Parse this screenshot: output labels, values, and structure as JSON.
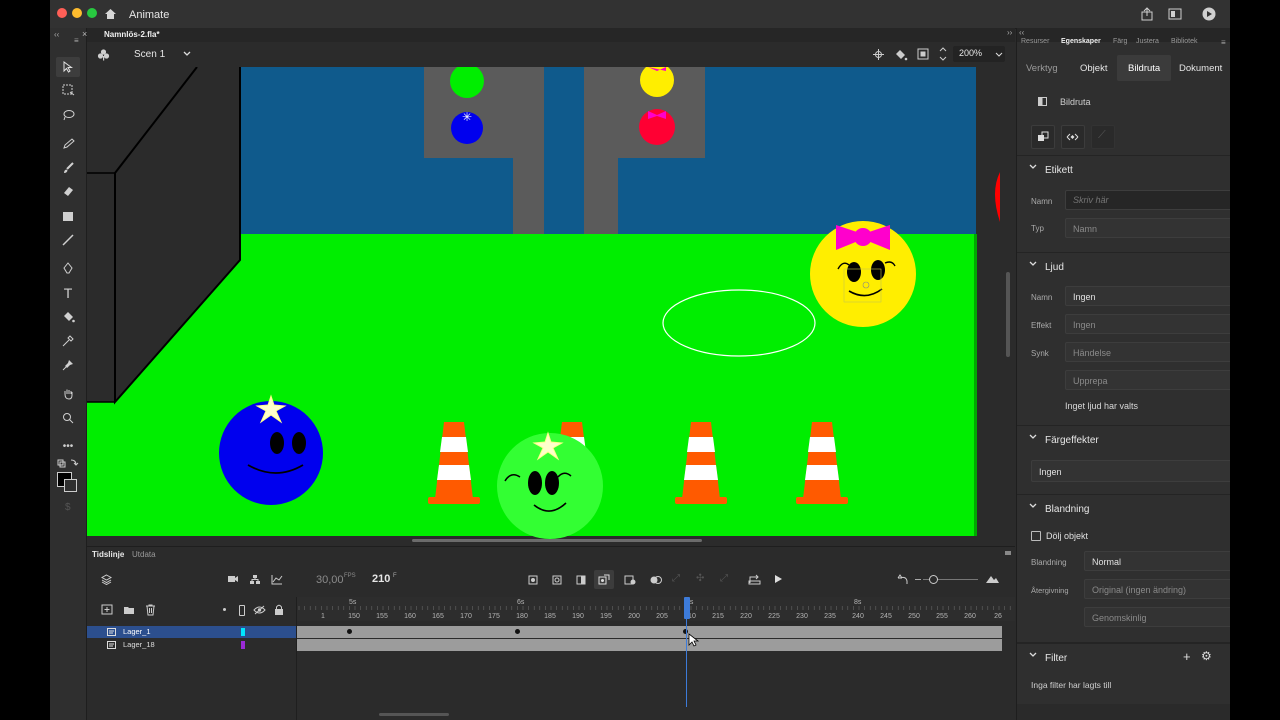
{
  "app": {
    "name": "Animate"
  },
  "document": {
    "tab": "Namnlös-2.fla*"
  },
  "scene": {
    "name": "Scen 1",
    "zoom": "200%"
  },
  "timeline": {
    "tabs": [
      "Tidslinje",
      "Utdata"
    ],
    "fps_value": "30,00",
    "fps_unit": "FPS",
    "frame_value": "210",
    "frame_unit": "F",
    "ruler_numbers": [
      "1",
      "150",
      "155",
      "160",
      "165",
      "170",
      "175",
      "180",
      "185",
      "190",
      "195",
      "200",
      "205",
      "210",
      "215",
      "220",
      "225",
      "230",
      "235",
      "240",
      "245",
      "250",
      "255",
      "260",
      "26"
    ],
    "seconds": [
      "5s",
      "6s",
      "7s",
      "8s"
    ],
    "layers": [
      {
        "name": "Lager_1",
        "color": "#00e5ff",
        "selected": true
      },
      {
        "name": "Lager_18",
        "color": "#9a2ad6",
        "selected": false
      }
    ]
  },
  "panel": {
    "top_tabs": [
      "Resurser",
      "Egenskaper",
      "Färg",
      "Justera",
      "Bibliotek"
    ],
    "active_top_tab": "Egenskaper",
    "sub_tabs": [
      "Verktyg",
      "Objekt",
      "Bildruta",
      "Dokument"
    ],
    "active_sub_tab": "Bildruta",
    "frame_title": "Bildruta",
    "label_section": {
      "title": "Etikett",
      "name_label": "Namn",
      "name_placeholder": "Skriv här",
      "type_label": "Typ",
      "type_value": "Namn"
    },
    "sound_section": {
      "title": "Ljud",
      "name_label": "Namn",
      "name_value": "Ingen",
      "effect_label": "Effekt",
      "effect_value": "Ingen",
      "sync_label": "Synk",
      "sync_value": "Händelse",
      "repeat_value": "Upprepa",
      "note": "Inget ljud har valts"
    },
    "color_effects": {
      "title": "Färgeffekter",
      "value": "Ingen"
    },
    "blending": {
      "title": "Blandning",
      "hide_label": "Dölj objekt",
      "blend_label": "Blandning",
      "blend_value": "Normal",
      "render_label": "Återgivning",
      "render_value": "Original (ingen ändring)",
      "transparent_value": "Genomskinlig"
    },
    "filter": {
      "title": "Filter",
      "note": "Inga filter har lagts till"
    }
  },
  "stage_colors": {
    "sky": "#0f5a8c",
    "grass": "#00ee00",
    "building": "#5b5b5b",
    "cone": "#ff5a00"
  }
}
